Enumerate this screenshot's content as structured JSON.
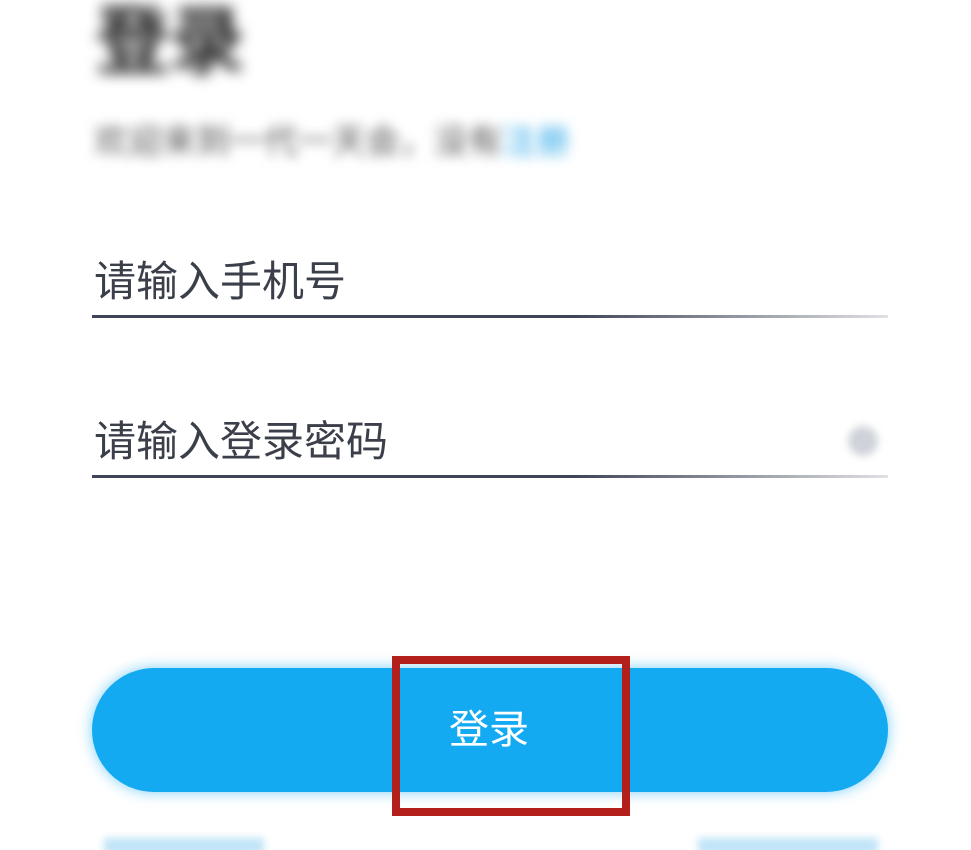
{
  "header": {
    "title": "登录",
    "subtitle": "欢迎来到一代一天会，没有",
    "subtitle_link": "注册"
  },
  "form": {
    "phone": {
      "placeholder": "请输入手机号",
      "value": ""
    },
    "password": {
      "placeholder": "请输入登录密码",
      "value": ""
    },
    "submit_label": "登录"
  },
  "colors": {
    "primary": "#14aaf2",
    "highlight": "#b3201c",
    "underline": "#3d4456"
  },
  "icons": {
    "password_toggle": "eye-icon"
  }
}
